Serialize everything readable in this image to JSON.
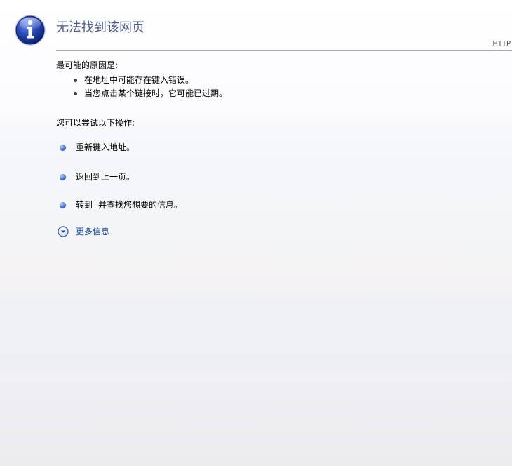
{
  "page": {
    "title": "无法找到该网页",
    "error_code": "HTTP"
  },
  "causes": {
    "heading": "最可能的原因是:",
    "items": [
      "在地址中可能存在键入错误。",
      "当您点击某个链接时，它可能已过期。"
    ]
  },
  "actions": {
    "heading": "您可以尝试以下操作:",
    "retype": "重新键入地址。",
    "go_back": "返回到上一页。",
    "search_prefix": "转到",
    "search_suffix": "并查找您想要的信息。"
  },
  "more_info": {
    "label": "更多信息"
  },
  "icons": {
    "main": "info-icon",
    "bullet": "blue-ball-bullet-icon",
    "expand": "expand-down-icon"
  }
}
